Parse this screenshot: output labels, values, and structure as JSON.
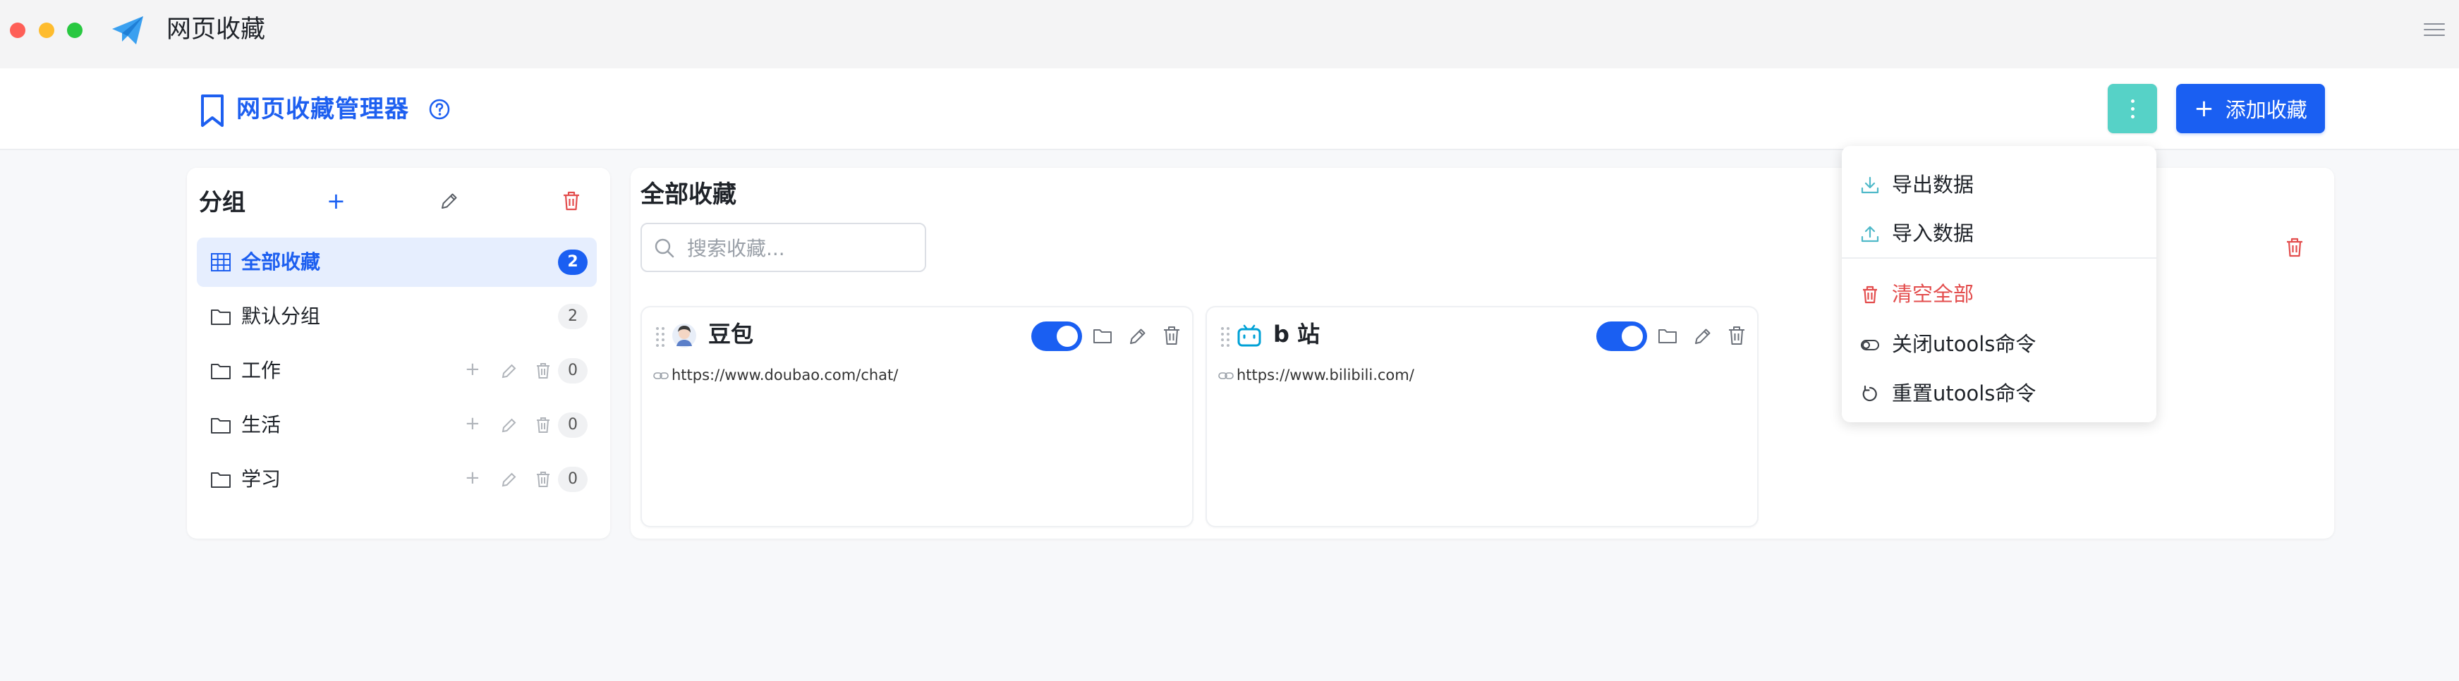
{
  "window": {
    "app_title": "网页收藏"
  },
  "header": {
    "title": "网页收藏管理器",
    "add_button_label": "添加收藏",
    "add_button_plus": "+"
  },
  "sidebar": {
    "title": "分组",
    "add_symbol": "+",
    "groups": [
      {
        "label": "全部收藏",
        "count": "2",
        "active": true
      },
      {
        "label": "默认分组",
        "count": "2"
      },
      {
        "label": "工作",
        "count": "0"
      },
      {
        "label": "生活",
        "count": "0"
      },
      {
        "label": "学习",
        "count": "0"
      }
    ],
    "group_add_symbol": "+"
  },
  "main": {
    "title": "全部收藏",
    "search_placeholder": "搜索收藏...",
    "cards": [
      {
        "title": "豆包",
        "url": "https://www.doubao.com/chat/",
        "enabled": true
      },
      {
        "title": "b 站",
        "url": "https://www.bilibili.com/",
        "enabled": true
      }
    ]
  },
  "dropdown": {
    "items": [
      {
        "label": "导出数据",
        "icon": "download-icon"
      },
      {
        "label": "导入数据",
        "icon": "upload-icon"
      },
      {
        "label": "清空全部",
        "icon": "trash-icon",
        "danger": true
      },
      {
        "label": "关闭utools命令",
        "icon": "toggle-off-icon"
      },
      {
        "label": "重置utools命令",
        "icon": "reset-icon"
      }
    ]
  },
  "colors": {
    "primary": "#1a5ff2",
    "accent_teal": "#56d2c7",
    "danger": "#e34d4d",
    "active_bg": "#e6eefe"
  }
}
